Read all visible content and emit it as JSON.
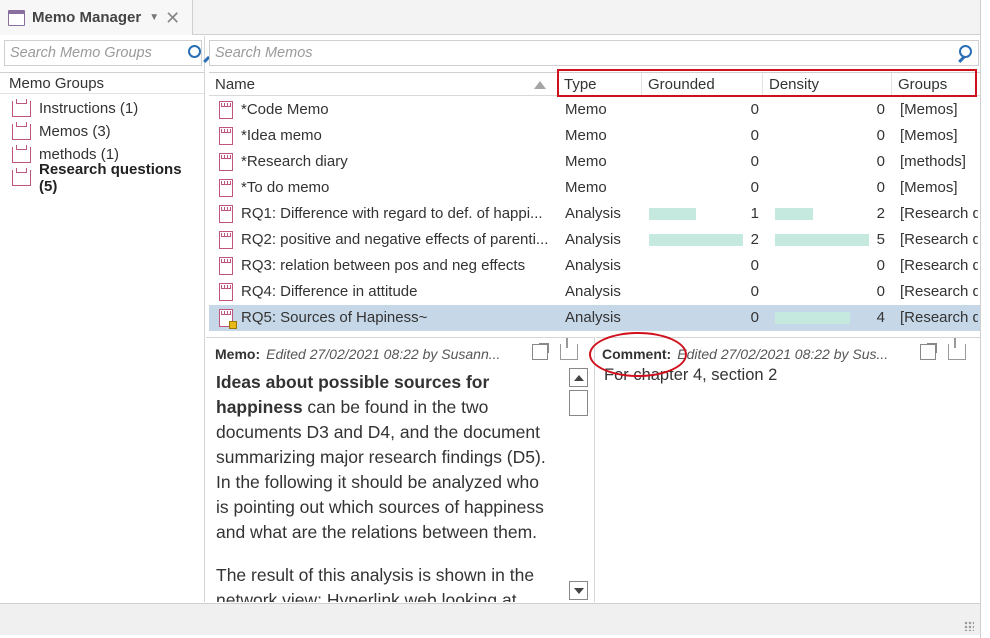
{
  "window": {
    "title": "Memo Manager"
  },
  "left": {
    "search_placeholder": "Search Memo Groups",
    "header": "Memo Groups",
    "groups": [
      {
        "label": "Instructions (1)",
        "bold": false
      },
      {
        "label": "Memos (3)",
        "bold": false
      },
      {
        "label": "methods (1)",
        "bold": false
      },
      {
        "label": "Research questions (5)",
        "bold": true
      }
    ]
  },
  "main": {
    "search_placeholder": "Search Memos",
    "columns": {
      "name": "Name",
      "type": "Type",
      "grounded": "Grounded",
      "density": "Density",
      "groups": "Groups"
    },
    "rows": [
      {
        "name": "*Code Memo",
        "type": "Memo",
        "grounded": "0",
        "density": "0",
        "groups": "[Memos]",
        "grounded_bar": 0,
        "density_bar": 0
      },
      {
        "name": "*Idea memo",
        "type": "Memo",
        "grounded": "0",
        "density": "0",
        "groups": "[Memos]",
        "grounded_bar": 0,
        "density_bar": 0
      },
      {
        "name": "*Research diary",
        "type": "Memo",
        "grounded": "0",
        "density": "0",
        "groups": "[methods]",
        "grounded_bar": 0,
        "density_bar": 0
      },
      {
        "name": "*To do memo",
        "type": "Memo",
        "grounded": "0",
        "density": "0",
        "groups": "[Memos]",
        "grounded_bar": 0,
        "density_bar": 0
      },
      {
        "name": "RQ1: Difference with regard to def. of happi...",
        "type": "Analysis",
        "grounded": "1",
        "density": "2",
        "groups": "[Research q",
        "grounded_bar": 0.5,
        "density_bar": 0.4
      },
      {
        "name": "RQ2: positive and negative effects of parenti...",
        "type": "Analysis",
        "grounded": "2",
        "density": "5",
        "groups": "[Research q",
        "grounded_bar": 1.0,
        "density_bar": 1.0
      },
      {
        "name": "RQ3: relation between pos and neg effects",
        "type": "Analysis",
        "grounded": "0",
        "density": "0",
        "groups": "[Research q",
        "grounded_bar": 0,
        "density_bar": 0
      },
      {
        "name": "RQ4: Difference in attitude",
        "type": "Analysis",
        "grounded": "0",
        "density": "0",
        "groups": "[Research q",
        "grounded_bar": 0,
        "density_bar": 0
      },
      {
        "name": "RQ5: Sources of Hapiness~",
        "type": "Analysis",
        "grounded": "0",
        "density": "4",
        "groups": "[Research q",
        "grounded_bar": 0,
        "density_bar": 0.8,
        "selected": true
      }
    ]
  },
  "memo_pane": {
    "label": "Memo:",
    "meta": "Edited 27/02/2021 08:22 by Susann...",
    "text_bold": "Ideas about possible sources for happiness",
    "text_rest": " can be found in the two documents D3 and D4, and the document summarizing major research findings (D5). In the following it should be analyzed who is pointing out which sources of happiness and what are the relations between them.",
    "text_p2": "The result of this analysis is shown in the network view: Hyperlink web looking at"
  },
  "comment_pane": {
    "label": "Comment:",
    "meta": "Edited 27/02/2021 08:22 by Sus...",
    "text": "For chapter 4, section 2"
  },
  "colors": {
    "bar": "#c5e9df",
    "selected_row": "#c6d7e8",
    "highlight": "#d1101d",
    "memo_icon": "#c0567f"
  }
}
